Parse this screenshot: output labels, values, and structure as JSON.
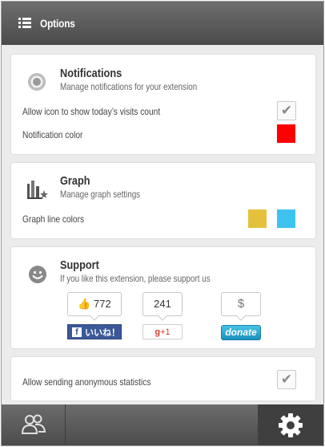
{
  "header": {
    "title": "Options",
    "menu_icon": "menu-icon"
  },
  "notifications": {
    "title": "Notifications",
    "subtitle": "Manage notifications for your extension",
    "icon": "target-icon",
    "rows": [
      {
        "label": "Allow icon to show today’s visits count",
        "checked": true
      },
      {
        "label": "Notification color",
        "color": "#ff0000"
      }
    ]
  },
  "graph": {
    "title": "Graph",
    "subtitle": "Manage graph settings",
    "icon": "bar-chart-icon",
    "line_colors_label": "Graph line colors",
    "colors": [
      "#e5c13b",
      "#3ec3f0"
    ]
  },
  "support": {
    "title": "Support",
    "subtitle": "If you like this extension, please support us",
    "icon": "smiley-icon",
    "like_count": "772",
    "facebook_label": "いいね！",
    "gplus_count": "241",
    "gplus_label": "+1",
    "donate_symbol": "$",
    "donate_label": "donate"
  },
  "statistics": {
    "label": "Allow sending anonymous statistics",
    "checked": true
  },
  "footer": {
    "left_icon": "users-icon",
    "right_icon": "gear-icon"
  }
}
